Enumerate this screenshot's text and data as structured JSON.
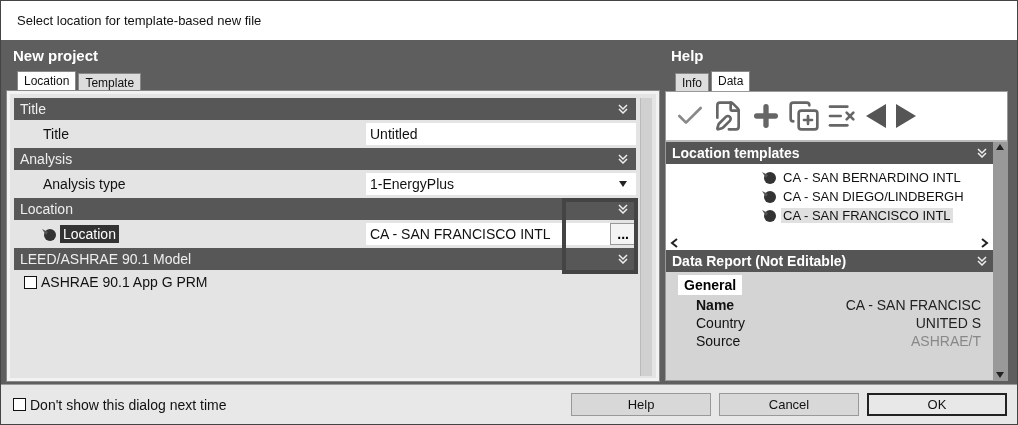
{
  "window": {
    "title": "Select location for template-based new file"
  },
  "left": {
    "title": "New project",
    "tabs": [
      {
        "label": "Location",
        "selected": true
      },
      {
        "label": "Template",
        "selected": false
      }
    ],
    "sections": [
      {
        "title": "Title",
        "expanded": true,
        "rows": [
          {
            "kind": "text",
            "label": "Title",
            "value": "Untitled",
            "selected": false
          }
        ]
      },
      {
        "title": "Analysis",
        "expanded": true,
        "rows": [
          {
            "kind": "dropdown",
            "label": "Analysis type",
            "value": "1-EnergyPlus",
            "selected": false
          }
        ]
      },
      {
        "title": "Location",
        "expanded": true,
        "rows": [
          {
            "kind": "browse",
            "label": "Location",
            "value": "CA - SAN FRANCISCO INTL",
            "button": "...",
            "selected": true
          }
        ]
      },
      {
        "title": "LEED/ASHRAE 90.1 Model",
        "expanded": true,
        "rows": [
          {
            "kind": "checkbox",
            "label": "ASHRAE 90.1 App G PRM",
            "checked": false
          }
        ]
      }
    ]
  },
  "right": {
    "title": "Help",
    "tabs": [
      {
        "label": "Info",
        "selected": false
      },
      {
        "label": "Data",
        "selected": true
      }
    ],
    "templates": {
      "title": "Location templates",
      "items": [
        {
          "label": "CA - SAN BERNARDINO INTL",
          "selected": false
        },
        {
          "label": "CA - SAN DIEGO/LINDBERGH",
          "selected": false
        },
        {
          "label": "CA - SAN FRANCISCO INTL",
          "selected": true
        }
      ]
    },
    "report": {
      "title": "Data Report (Not Editable)",
      "group": "General",
      "rows": [
        {
          "label": "Name",
          "value": "CA - SAN FRANCISC",
          "emphasized": true,
          "dimmed": false
        },
        {
          "label": "Country",
          "value": "UNITED S",
          "emphasized": false,
          "dimmed": false
        },
        {
          "label": "Source",
          "value": "ASHRAE/T",
          "emphasized": false,
          "dimmed": true
        }
      ]
    }
  },
  "footer": {
    "checkbox": {
      "label": "Don't show this dialog next time",
      "checked": false
    },
    "buttons": [
      {
        "label": "Help",
        "default": false
      },
      {
        "label": "Cancel",
        "default": false
      },
      {
        "label": "OK",
        "default": true
      }
    ]
  }
}
